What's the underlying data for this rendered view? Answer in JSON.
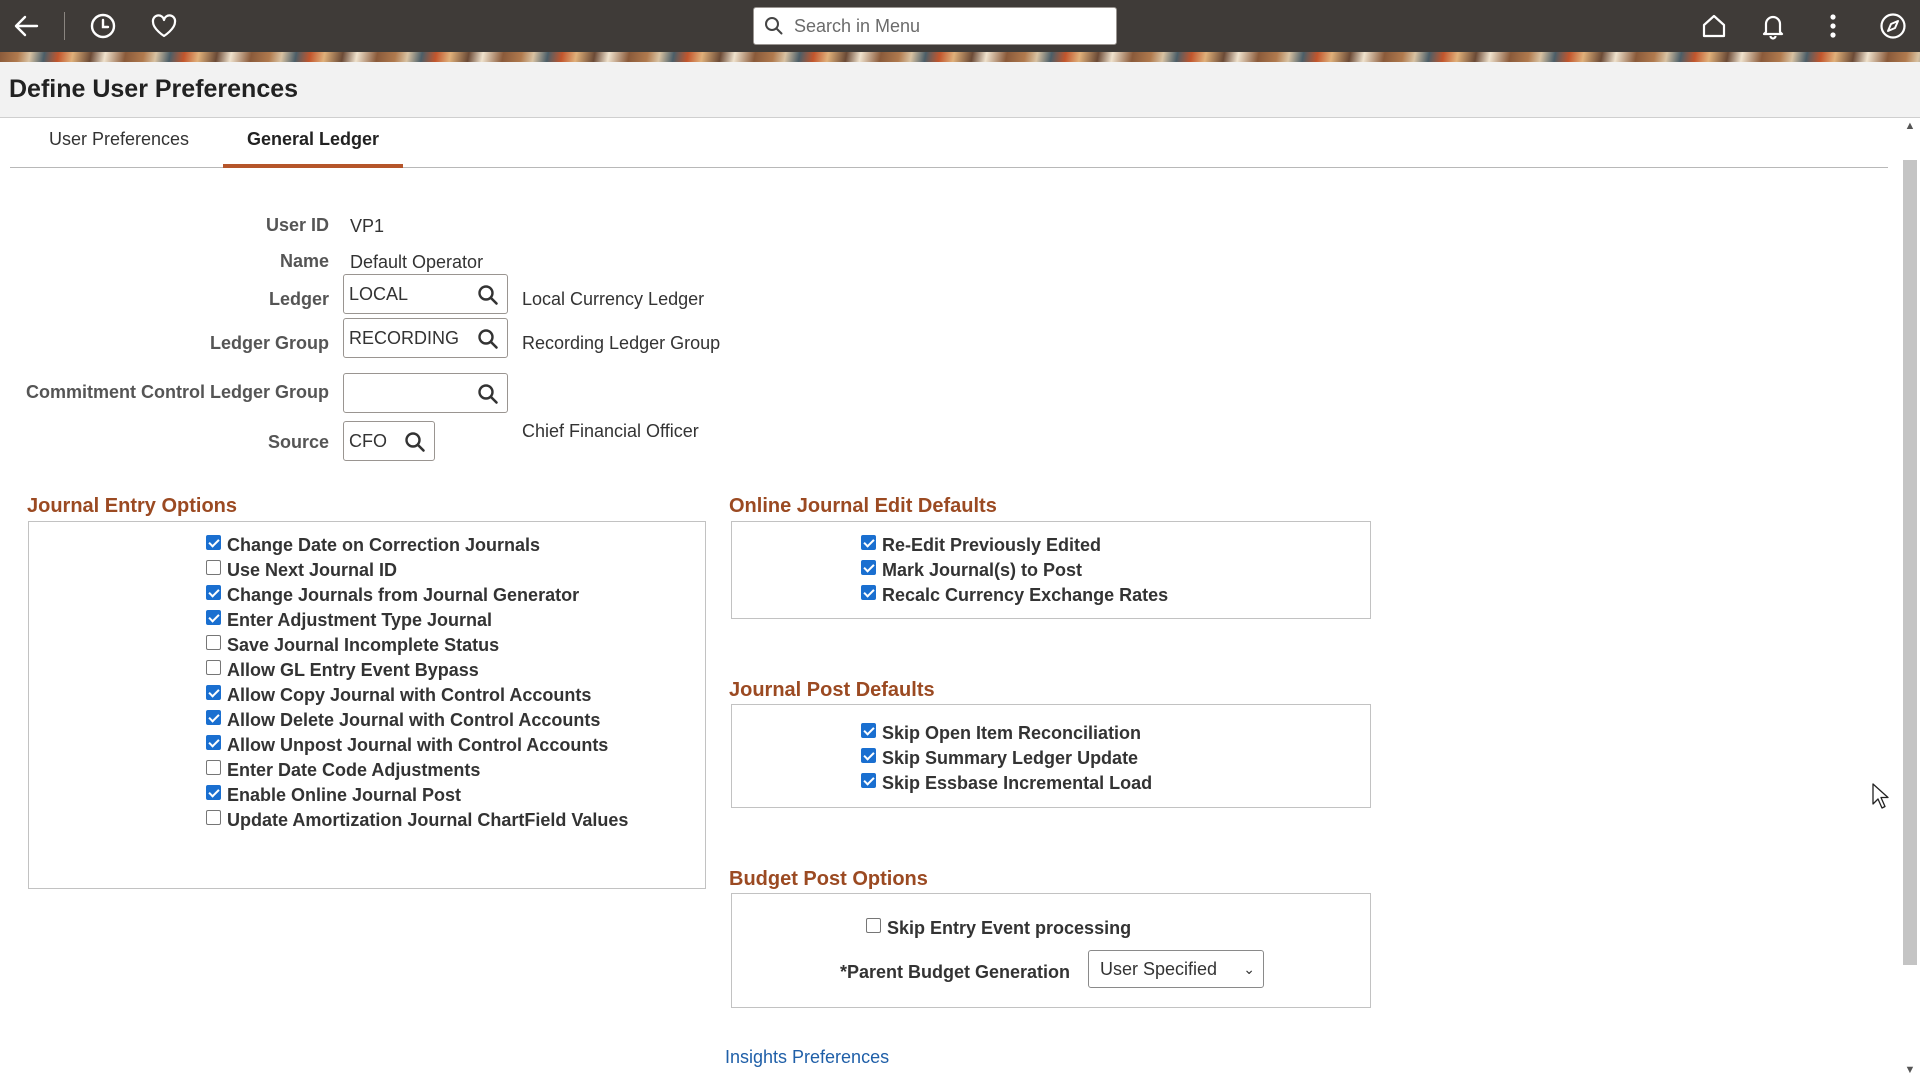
{
  "header": {
    "search_placeholder": "Search in Menu",
    "icons": [
      "back-arrow-icon",
      "history-icon",
      "favorites-heart-icon",
      "search-icon",
      "home-icon",
      "notification-bell-icon",
      "more-actions-icon",
      "navigator-compass-icon"
    ]
  },
  "page": {
    "title": "Define User Preferences"
  },
  "tabs": [
    {
      "label": "User Preferences",
      "active": false
    },
    {
      "label": "General Ledger",
      "active": true
    }
  ],
  "fields": {
    "user_id": {
      "label": "User ID",
      "value": "VP1"
    },
    "name": {
      "label": "Name",
      "value": "Default Operator"
    },
    "ledger": {
      "label": "Ledger",
      "value": "LOCAL",
      "description": "Local Currency Ledger"
    },
    "ledger_group": {
      "label": "Ledger Group",
      "value": "RECORDING",
      "description": "Recording Ledger Group"
    },
    "cc_ledger_group": {
      "label": "Commitment Control Ledger Group",
      "value": ""
    },
    "source": {
      "label": "Source",
      "value": "CFO",
      "description": "Chief Financial Officer"
    }
  },
  "journal_entry_options": {
    "title": "Journal Entry Options",
    "items": [
      {
        "label": "Change Date on Correction Journals",
        "checked": true
      },
      {
        "label": "Use Next Journal ID",
        "checked": false
      },
      {
        "label": "Change Journals from Journal Generator",
        "checked": true
      },
      {
        "label": "Enter Adjustment Type Journal",
        "checked": true
      },
      {
        "label": "Save Journal Incomplete Status",
        "checked": false
      },
      {
        "label": "Allow GL Entry Event Bypass",
        "checked": false
      },
      {
        "label": "Allow Copy Journal with Control Accounts",
        "checked": true
      },
      {
        "label": "Allow Delete Journal with Control Accounts",
        "checked": true
      },
      {
        "label": "Allow Unpost Journal with Control Accounts",
        "checked": true
      },
      {
        "label": "Enter Date Code Adjustments",
        "checked": false
      },
      {
        "label": "Enable Online Journal Post",
        "checked": true
      },
      {
        "label": "Update Amortization Journal ChartField Values",
        "checked": false
      }
    ]
  },
  "online_journal_edit_defaults": {
    "title": "Online Journal Edit Defaults",
    "items": [
      {
        "label": "Re-Edit Previously Edited",
        "checked": true
      },
      {
        "label": "Mark Journal(s) to Post",
        "checked": true
      },
      {
        "label": "Recalc Currency Exchange Rates",
        "checked": true
      }
    ]
  },
  "journal_post_defaults": {
    "title": "Journal Post Defaults",
    "items": [
      {
        "label": "Skip Open Item Reconciliation",
        "checked": true
      },
      {
        "label": "Skip Summary Ledger Update",
        "checked": true
      },
      {
        "label": "Skip Essbase Incremental Load",
        "checked": true
      }
    ]
  },
  "budget_post_options": {
    "title": "Budget Post Options",
    "skip_entry_event": {
      "label": "Skip Entry Event processing",
      "checked": false
    },
    "parent_budget_generation": {
      "label": "*Parent Budget Generation",
      "selected": "User Specified"
    }
  },
  "links": {
    "insights": "Insights Preferences"
  },
  "colors": {
    "header_bg": "#3f3b38",
    "section_title": "#9b4a22",
    "tab_underline": "#b5552a",
    "link": "#1f5fa8",
    "checkbox": "#1a6fd0"
  }
}
